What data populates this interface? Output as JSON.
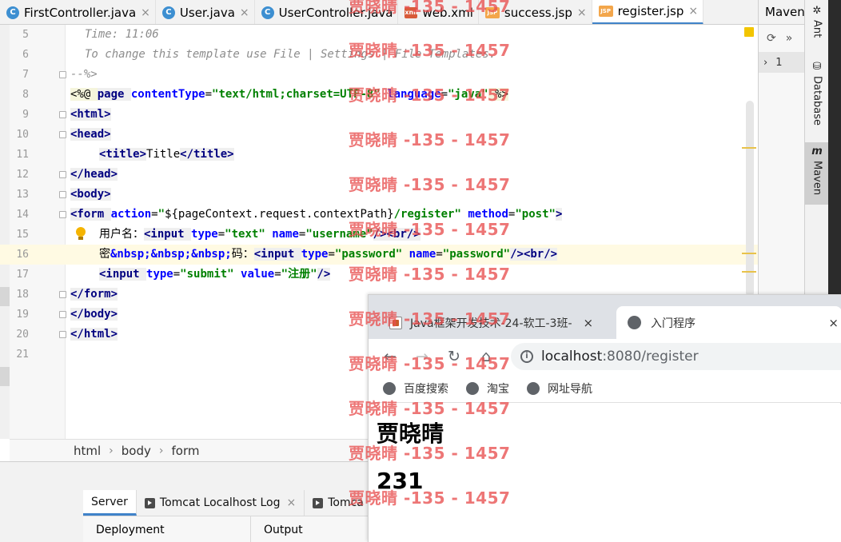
{
  "editor_tabs": [
    {
      "label": "FirstController.java",
      "icon": "C",
      "kind": "class"
    },
    {
      "label": "User.java",
      "icon": "C",
      "kind": "class"
    },
    {
      "label": "UserController.java",
      "icon": "C",
      "kind": "class"
    },
    {
      "label": "web.xml",
      "icon": "xml",
      "kind": "xml"
    },
    {
      "label": "success.jsp",
      "icon": "JSP",
      "kind": "jsp"
    },
    {
      "label": "register.jsp",
      "icon": "JSP",
      "kind": "jsp"
    }
  ],
  "tab_close": "×",
  "maven": {
    "title": "Maven",
    "row_label": "1"
  },
  "side_tools": {
    "ant": "Ant",
    "database": "Database",
    "maven": "Maven"
  },
  "line_numbers": [
    "5",
    "6",
    "7",
    "8",
    "9",
    "10",
    "11",
    "12",
    "13",
    "14",
    "15",
    "16",
    "17",
    "18",
    "19",
    "20",
    "21"
  ],
  "code": {
    "l5": "Time: 11:06",
    "l6": "To change this template use File | Settings | File Templates.",
    "l7": "--%>",
    "l8_open": "<%@ ",
    "l8_page": "page ",
    "l8_a1": "contentType",
    "l8_eq": "=",
    "l8_v1": "\"text/html;charset=UTF-8\"",
    "l8_a2": "language",
    "l8_v2": "\"java\"",
    "l8_close": " %>",
    "html_open": "<html>",
    "head_open": "<head>",
    "title_open": "<title>",
    "title_text": "Title",
    "title_close": "</title>",
    "head_close": "</head>",
    "body_open": "<body>",
    "form_tag": "<form ",
    "form_a1": "action",
    "form_v1_pre": "\"",
    "form_v1_el": "${pageContext.request.contextPath}",
    "form_v1_post": "/register\"",
    "form_a2": "method",
    "form_v2": "\"post\"",
    "gt": ">",
    "l15_label": "用户名：",
    "input_tag": "<input ",
    "type_attr": "type",
    "l15_type": "\"text\"",
    "name_attr": "name",
    "l15_name": "\"username\"",
    "self_close": "/>",
    "br": "<br/>",
    "l16_mi": "密",
    "l16_nbsp": "&nbsp;&nbsp;&nbsp;",
    "l16_ma": "码：",
    "l16_type": "\"password\"",
    "l16_name": "\"password\"",
    "value_attr": "value",
    "l17_type": "\"submit\"",
    "l17_value": "\"注册\"",
    "form_close": "</form>",
    "body_close": "</body>",
    "html_close": "</html>"
  },
  "breadcrumb": [
    "html",
    "body",
    "form"
  ],
  "breadcrumb_sep": "›",
  "bottom_tabs": [
    {
      "label": "Server",
      "active": true
    },
    {
      "label": "Tomcat Localhost Log",
      "active": false
    },
    {
      "label": "Tomca",
      "active": false
    }
  ],
  "bottom_columns": [
    "Deployment",
    "Output"
  ],
  "browser": {
    "tab1": "Java框架开发技术-24-软工-3班-",
    "tab2": "入门程序",
    "close": "×",
    "url_host": "localhost",
    "url_rest": ":8080/register",
    "bookmarks": [
      "百度搜索",
      "淘宝",
      "网址导航"
    ],
    "result_name": "贾晓晴",
    "result_password": "231"
  },
  "watermark": "贾晓晴 -135 - 1457"
}
